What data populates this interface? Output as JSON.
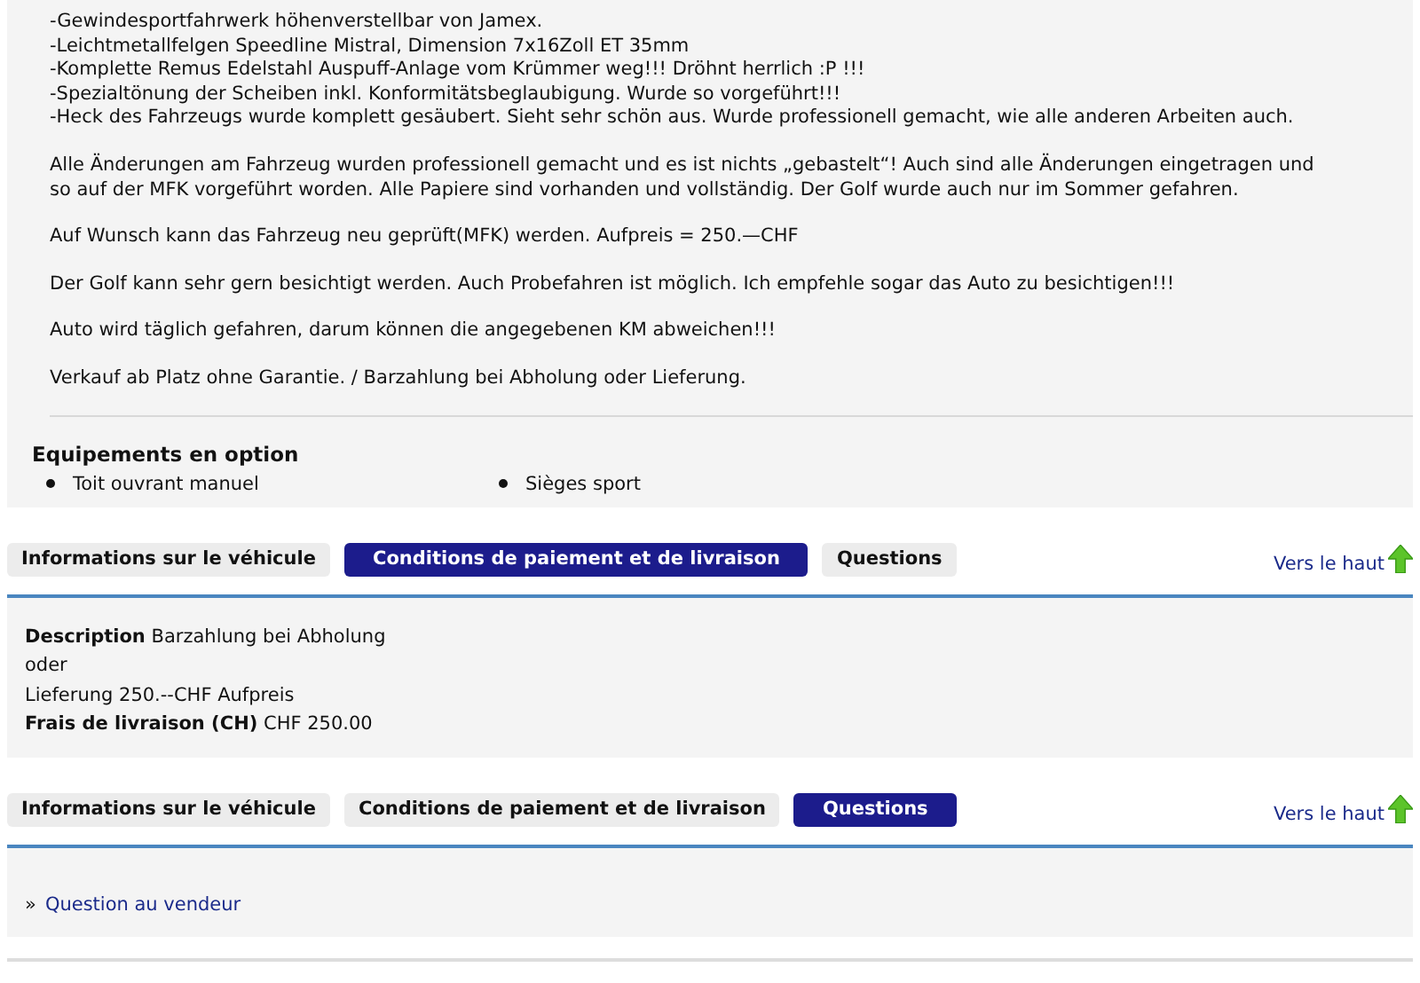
{
  "description": {
    "paragraphs": [
      [
        "-Gewindesportfahrwerk höhenverstellbar von Jamex.",
        "-Leichtmetallfelgen Speedline Mistral, Dimension 7x16Zoll ET 35mm",
        "-Komplette Remus Edelstahl Auspuff-Anlage vom Krümmer weg!!! Dröhnt herrlich :P !!!",
        "-Spezialtönung der Scheiben inkl. Konformitätsbeglaubigung. Wurde so vorgeführt!!!",
        "-Heck des Fahrzeugs wurde komplett gesäubert. Sieht sehr schön aus. Wurde professionell gemacht, wie alle anderen Arbeiten auch."
      ],
      [
        "Alle Änderungen am Fahrzeug wurden professionell gemacht und es ist nichts „gebastelt“! Auch sind alle Änderungen eingetragen und so auf der MFK vorgeführt worden. Alle Papiere sind vorhanden und vollständig. Der Golf wurde auch nur im Sommer gefahren."
      ],
      [
        "Auf Wunsch kann das Fahrzeug neu geprüft(MFK) werden. Aufpreis = 250.—CHF"
      ],
      [
        "Der Golf kann sehr gern besichtigt werden. Auch Probefahren ist möglich. Ich empfehle sogar das Auto zu besichtigen!!!"
      ],
      [
        "Auto wird täglich gefahren, darum können die angegebenen KM abweichen!!!"
      ],
      [
        "Verkauf ab Platz ohne Garantie. / Barzahlung bei Abholung oder Lieferung."
      ]
    ]
  },
  "options": {
    "title": "Equipements en option",
    "items": [
      "Toit ouvrant manuel",
      "Sièges sport"
    ]
  },
  "sections": [
    {
      "tabs": [
        {
          "label": "Informations sur le véhicule",
          "selected": false
        },
        {
          "label": "Conditions de paiement et de livraison",
          "selected": true
        },
        {
          "label": "Questions",
          "selected": false
        }
      ],
      "back_to_top": "Vers le haut",
      "kind": "text",
      "lines": [
        "**Description** Barzahlung bei Abholung",
        "oder",
        "Lieferung 250.--CHF Aufpreis",
        "**Frais de livraison (CH)** CHF 250.00"
      ]
    },
    {
      "tabs": [
        {
          "label": "Informations sur le véhicule",
          "selected": false
        },
        {
          "label": "Conditions de paiement et de livraison",
          "selected": false
        },
        {
          "label": "Questions",
          "selected": true
        }
      ],
      "back_to_top": "Vers le haut",
      "kind": "link",
      "prefix": "»",
      "link": "Question au vendeur"
    }
  ]
}
